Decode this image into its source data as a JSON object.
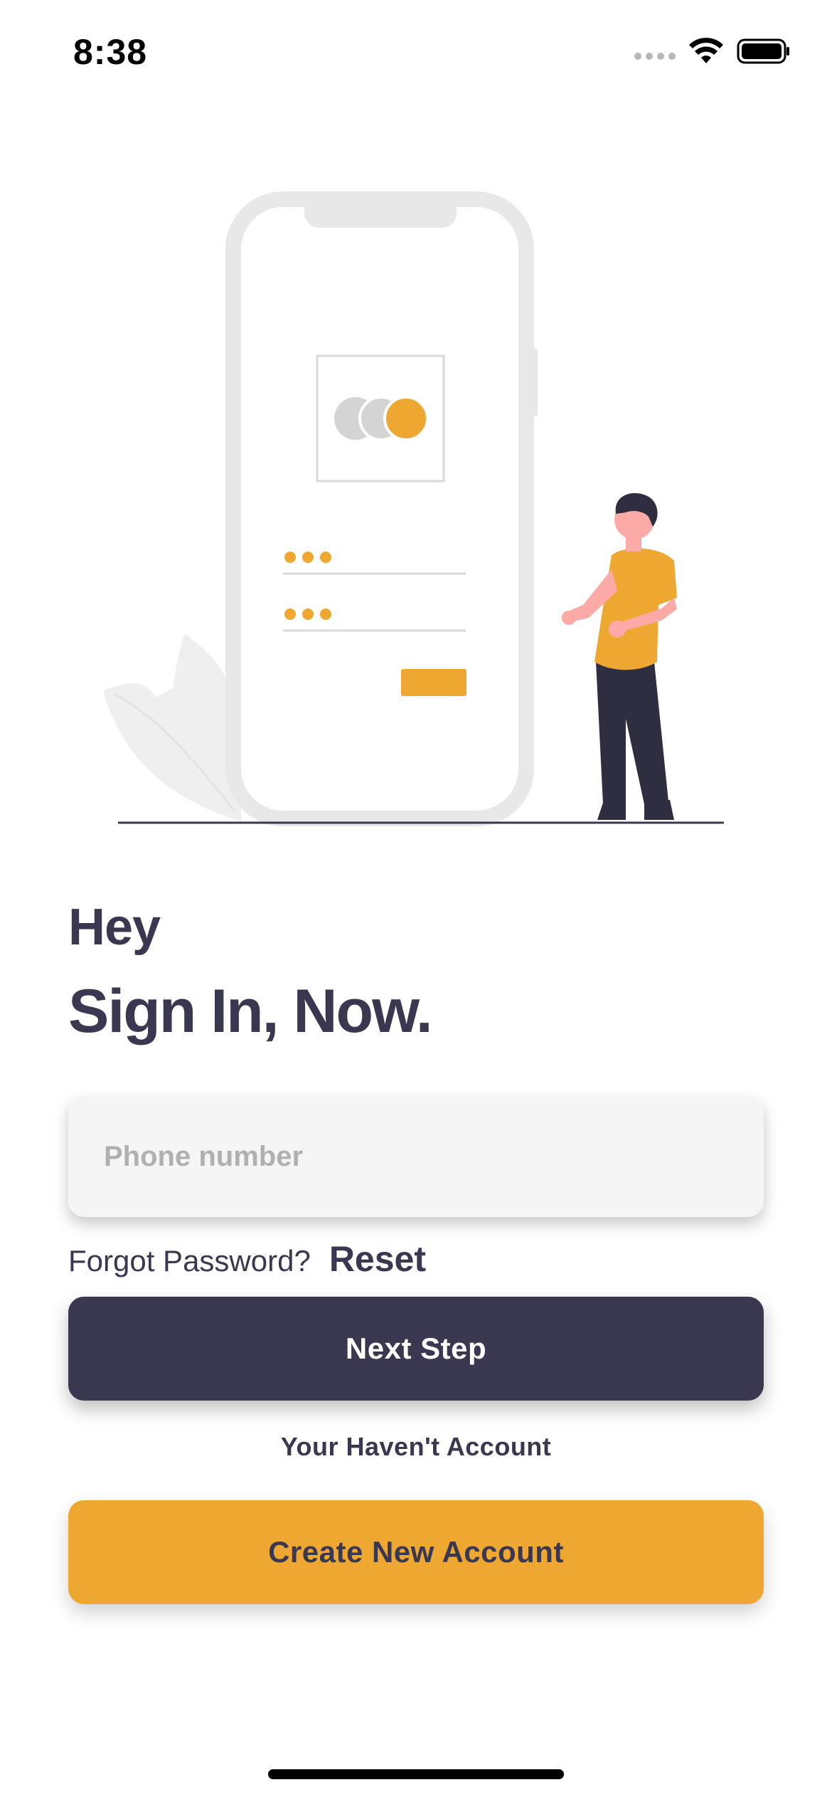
{
  "status_bar": {
    "time": "8:38",
    "icons": [
      "cellular-signal-icon",
      "wifi-icon",
      "battery-icon"
    ]
  },
  "illustration": {
    "description_icons": [
      "phone-mockup-icon",
      "person-icon",
      "leaf-icon",
      "card-logo-icon"
    ]
  },
  "heading": {
    "greeting": "Hey",
    "title": "Sign In, Now."
  },
  "form": {
    "phone_placeholder": "Phone number",
    "phone_value": ""
  },
  "forgot": {
    "prompt": "Forgot Password?",
    "link": "Reset"
  },
  "actions": {
    "next_label": "Next Step",
    "no_account_text": "Your Haven't Account",
    "create_label": "Create New Account"
  },
  "colors": {
    "primary_dark": "#3a3850",
    "accent": "#eea832",
    "field_bg": "#f5f5f5",
    "placeholder": "#b0b0b0"
  }
}
